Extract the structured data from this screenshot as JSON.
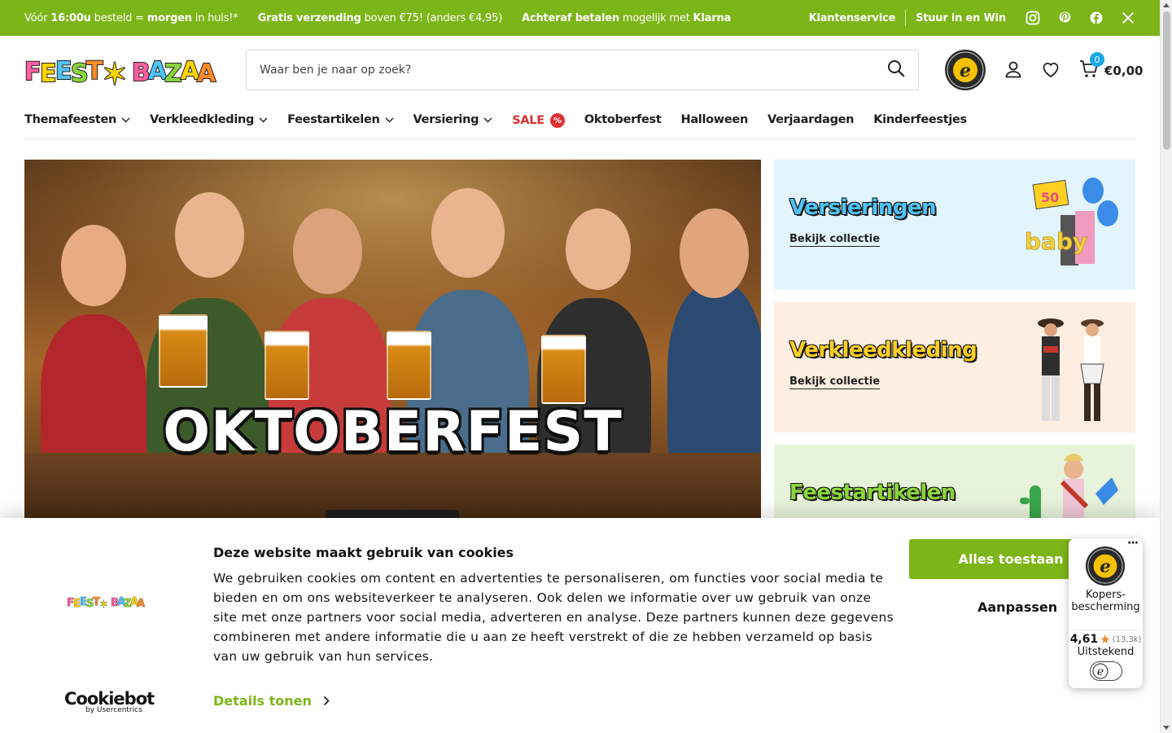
{
  "topbar": {
    "msg1_a": "Vóór ",
    "msg1_b": "16:00u",
    "msg1_c": " besteld = ",
    "msg1_d": "morgen",
    "msg1_e": " in huis!*",
    "msg2_a": "Gratis verzending",
    "msg2_b": " boven €75! (anders €4,95)",
    "msg3_a": "Achteraf betalen",
    "msg3_b": " mogelijk met ",
    "msg3_c": "Klarna",
    "service": "Klantenservice",
    "win": "Stuur in en Win",
    "social_icons": [
      "instagram-icon",
      "pinterest-icon",
      "facebook-icon",
      "x-icon"
    ]
  },
  "header": {
    "logo_text": "FEEST BAZAAR",
    "search_placeholder": "Waar ben je naar op zoek?",
    "cart_count": "0",
    "cart_total": "€0,00"
  },
  "nav": {
    "items": [
      "Themafeesten",
      "Verkleedkleding",
      "Feestartikelen",
      "Versiering"
    ],
    "sale": "SALE",
    "sale_badge": "%",
    "links": [
      "Oktoberfest",
      "Halloween",
      "Verjaardagen",
      "Kinderfeestjes"
    ]
  },
  "hero": {
    "title": "OKTOBERFEST"
  },
  "cards": [
    {
      "title": "Versieringen",
      "link": "Bekijk collectie"
    },
    {
      "title": "Verkleedkleding",
      "link": "Bekijk collectie"
    },
    {
      "title": "Feestartikelen"
    }
  ],
  "cookie": {
    "title": "Deze website maakt gebruik van cookies",
    "text": "We gebruiken cookies om content en advertenties te personaliseren, om functies voor social media te bieden en om ons websiteverkeer te analyseren. Ook delen we informatie over uw gebruik van onze site met onze partners voor social media, adverteren en analyse. Deze partners kunnen deze gegevens combineren met andere informatie die u aan ze heeft verstrekt of die ze hebben verzameld op basis van uw gebruik van hun services.",
    "details": "Details tonen",
    "allow": "Alles toestaan",
    "customize": "Aanpassen",
    "brand": "Cookiebot",
    "brand_sub": "by Usercentrics"
  },
  "trust_badge": {
    "label": "Kopers-bescherming",
    "score": "4,61",
    "count": "(13,3k)",
    "rating": "Uitstekend"
  },
  "colors": {
    "brand_green": "#7cb518",
    "sale_red": "#e03131",
    "cart_badge": "#1aa6e8"
  }
}
